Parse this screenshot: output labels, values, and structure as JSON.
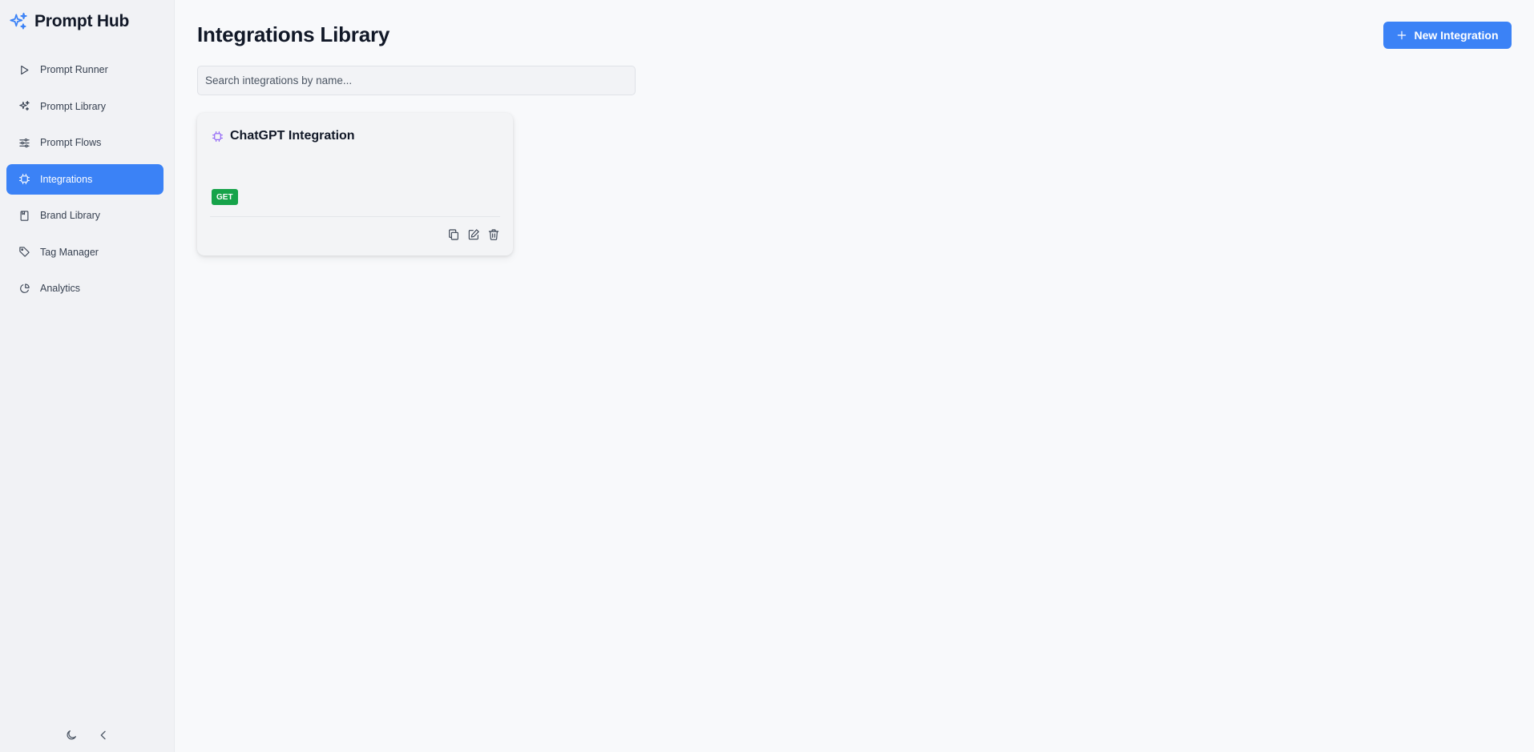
{
  "app": {
    "title": "Prompt Hub",
    "accent_color": "#3b82f6"
  },
  "sidebar": {
    "items": [
      {
        "label": "Prompt Runner",
        "icon": "play-icon",
        "active": false
      },
      {
        "label": "Prompt Library",
        "icon": "sparkles-icon",
        "active": false
      },
      {
        "label": "Prompt Flows",
        "icon": "sliders-icon",
        "active": false
      },
      {
        "label": "Integrations",
        "icon": "chip-icon",
        "active": true
      },
      {
        "label": "Brand Library",
        "icon": "book-icon",
        "active": false
      },
      {
        "label": "Tag Manager",
        "icon": "tag-icon",
        "active": false
      },
      {
        "label": "Analytics",
        "icon": "pie-chart-icon",
        "active": false
      }
    ],
    "footer": {
      "theme_icon": "moon-icon",
      "collapse_icon": "chevron-left-icon"
    }
  },
  "main": {
    "title": "Integrations Library",
    "new_button_label": "New Integration",
    "search": {
      "placeholder": "Search integrations by name...",
      "value": ""
    },
    "integrations": [
      {
        "name": "ChatGPT Integration",
        "method": "GET",
        "method_color": "#16a34a",
        "actions": [
          "copy-icon",
          "edit-icon",
          "trash-icon"
        ]
      }
    ]
  }
}
